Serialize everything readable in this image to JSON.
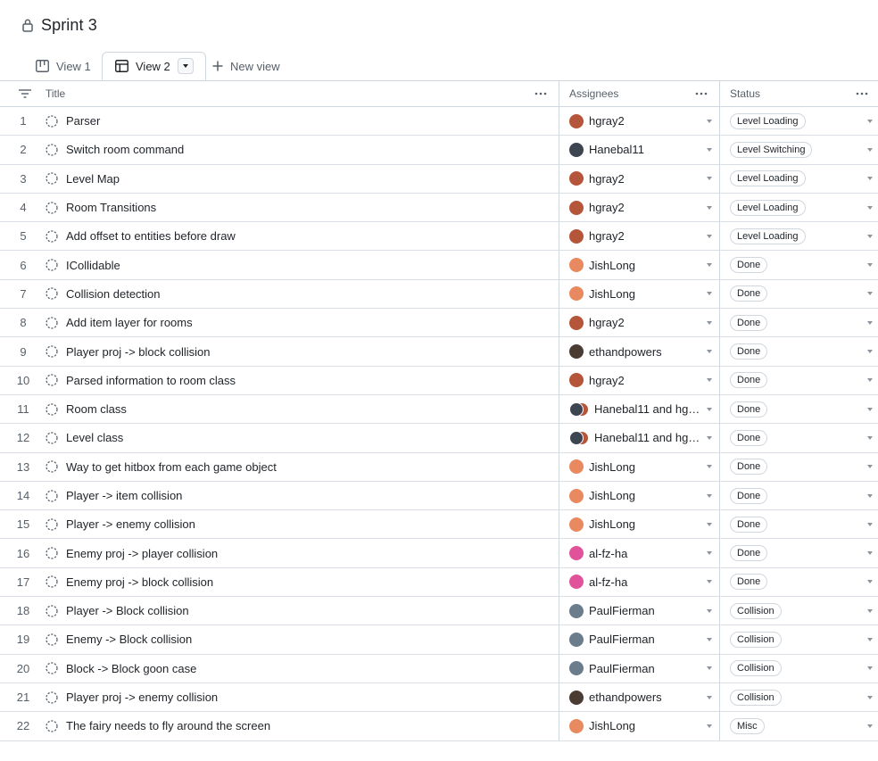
{
  "project": {
    "title": "Sprint 3"
  },
  "tabs": [
    {
      "label": "View 1"
    },
    {
      "label": "View 2"
    },
    {
      "label": "New view"
    }
  ],
  "columns": {
    "title": "Title",
    "assignees": "Assignees",
    "status": "Status"
  },
  "rows": [
    {
      "num": "1",
      "title": "Parser",
      "assignee": "hgray2",
      "avatar": "hgray2",
      "status": "Level Loading"
    },
    {
      "num": "2",
      "title": "Switch room command",
      "assignee": "Hanebal11",
      "avatar": "hanebal",
      "status": "Level Switching"
    },
    {
      "num": "3",
      "title": "Level Map",
      "assignee": "hgray2",
      "avatar": "hgray2",
      "status": "Level Loading"
    },
    {
      "num": "4",
      "title": "Room Transitions",
      "assignee": "hgray2",
      "avatar": "hgray2",
      "status": "Level Loading"
    },
    {
      "num": "5",
      "title": "Add offset to entities before draw",
      "assignee": "hgray2",
      "avatar": "hgray2",
      "status": "Level Loading"
    },
    {
      "num": "6",
      "title": "ICollidable",
      "assignee": "JishLong",
      "avatar": "jish",
      "status": "Done"
    },
    {
      "num": "7",
      "title": "Collision detection",
      "assignee": "JishLong",
      "avatar": "jish",
      "status": "Done"
    },
    {
      "num": "8",
      "title": "Add item layer for rooms",
      "assignee": "hgray2",
      "avatar": "hgray2",
      "status": "Done"
    },
    {
      "num": "9",
      "title": "Player proj -> block collision",
      "assignee": "ethandpowers",
      "avatar": "ethan",
      "status": "Done"
    },
    {
      "num": "10",
      "title": "Parsed information to room class",
      "assignee": "hgray2",
      "avatar": "hgray2",
      "status": "Done"
    },
    {
      "num": "11",
      "title": "Room class",
      "assignee": "Hanebal11 and hgr…",
      "avatar": "pair",
      "status": "Done"
    },
    {
      "num": "12",
      "title": "Level class",
      "assignee": "Hanebal11 and hgr…",
      "avatar": "pair",
      "status": "Done"
    },
    {
      "num": "13",
      "title": "Way to get hitbox from each game object",
      "assignee": "JishLong",
      "avatar": "jish",
      "status": "Done"
    },
    {
      "num": "14",
      "title": "Player -> item collision",
      "assignee": "JishLong",
      "avatar": "jish",
      "status": "Done"
    },
    {
      "num": "15",
      "title": "Player -> enemy collision",
      "assignee": "JishLong",
      "avatar": "jish",
      "status": "Done"
    },
    {
      "num": "16",
      "title": "Enemy proj -> player collision",
      "assignee": "al-fz-ha",
      "avatar": "alfz",
      "status": "Done"
    },
    {
      "num": "17",
      "title": "Enemy proj -> block collision",
      "assignee": "al-fz-ha",
      "avatar": "alfz",
      "status": "Done"
    },
    {
      "num": "18",
      "title": "Player -> Block collision",
      "assignee": "PaulFierman",
      "avatar": "paul",
      "status": "Collision"
    },
    {
      "num": "19",
      "title": "Enemy -> Block collision",
      "assignee": "PaulFierman",
      "avatar": "paul",
      "status": "Collision"
    },
    {
      "num": "20",
      "title": "Block -> Block goon case",
      "assignee": "PaulFierman",
      "avatar": "paul",
      "status": "Collision"
    },
    {
      "num": "21",
      "title": "Player proj -> enemy collision",
      "assignee": "ethandpowers",
      "avatar": "ethan",
      "status": "Collision"
    },
    {
      "num": "22",
      "title": "The fairy needs to fly around the screen",
      "assignee": "JishLong",
      "avatar": "jish",
      "status": "Misc"
    }
  ],
  "avatar_colors": {
    "hgray2": "#b5553a",
    "hanebal": "#3d4550",
    "jish": "#e8895f",
    "ethan": "#4a3b33",
    "alfz": "#e0529a",
    "paul": "#6b7c8c"
  },
  "icons": {
    "lock": "lock-icon",
    "board": "board-icon",
    "table": "table-icon",
    "plus": "plus-icon",
    "filter": "filter-icon",
    "more": "kebab-icon",
    "issue": "draft-issue-icon"
  }
}
